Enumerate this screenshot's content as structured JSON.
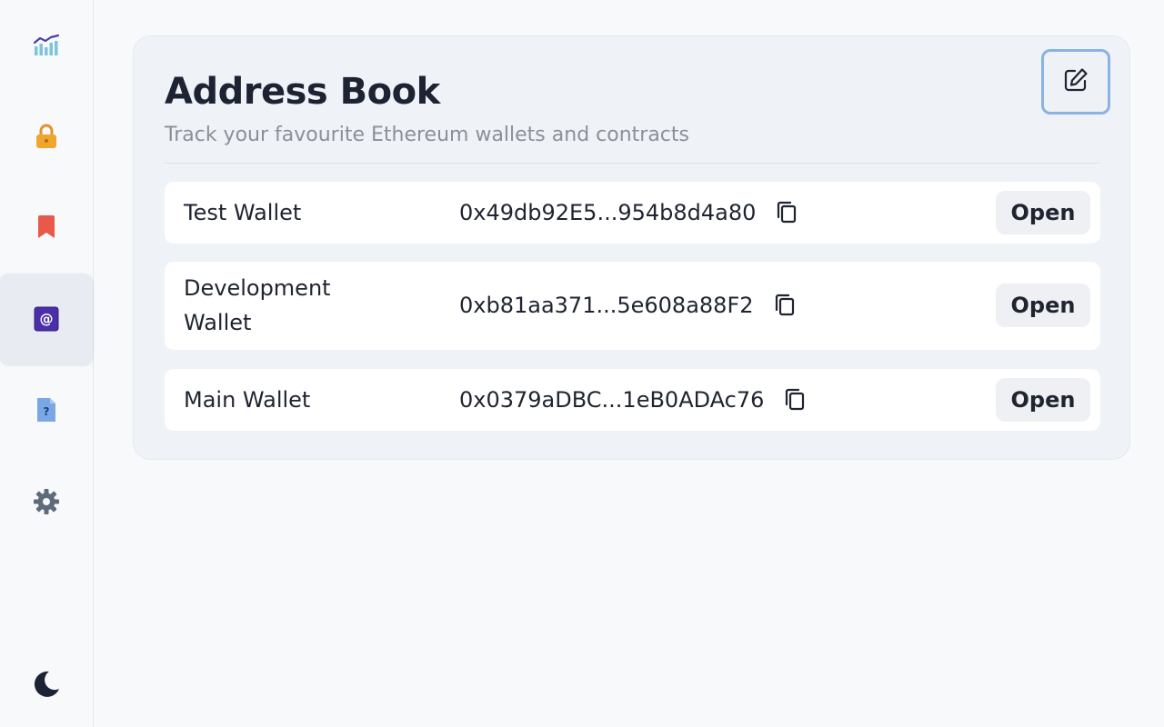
{
  "sidebar": {
    "items": [
      {
        "icon": "chart-icon",
        "active": false
      },
      {
        "icon": "lock-icon",
        "active": false
      },
      {
        "icon": "bookmark-icon",
        "active": false
      },
      {
        "icon": "at-address-icon",
        "active": true
      },
      {
        "icon": "help-document-icon",
        "active": false
      },
      {
        "icon": "gear-icon",
        "active": false
      },
      {
        "icon": "moon-icon",
        "active": false
      }
    ]
  },
  "colors": {
    "lock": "#f0a52c",
    "bookmark": "#e8594b",
    "at_icon": "#4b2fa8",
    "help_doc": "#7aa7e6",
    "gear": "#5d6b7a",
    "moon": "#1c2333",
    "edit_border": "#8ab2e3"
  },
  "main": {
    "title": "Address Book",
    "subtitle": "Track your favourite Ethereum wallets and contracts",
    "edit_icon": "edit-icon",
    "entries": [
      {
        "name": "Test Wallet",
        "address": "0x49db92E5...954b8d4a80",
        "action": "Open"
      },
      {
        "name": "Development Wallet",
        "address": "0xb81aa371...5e608a88F2",
        "action": "Open"
      },
      {
        "name": "Main Wallet",
        "address": "0x0379aDBC...1eB0ADAc76",
        "action": "Open"
      }
    ]
  }
}
